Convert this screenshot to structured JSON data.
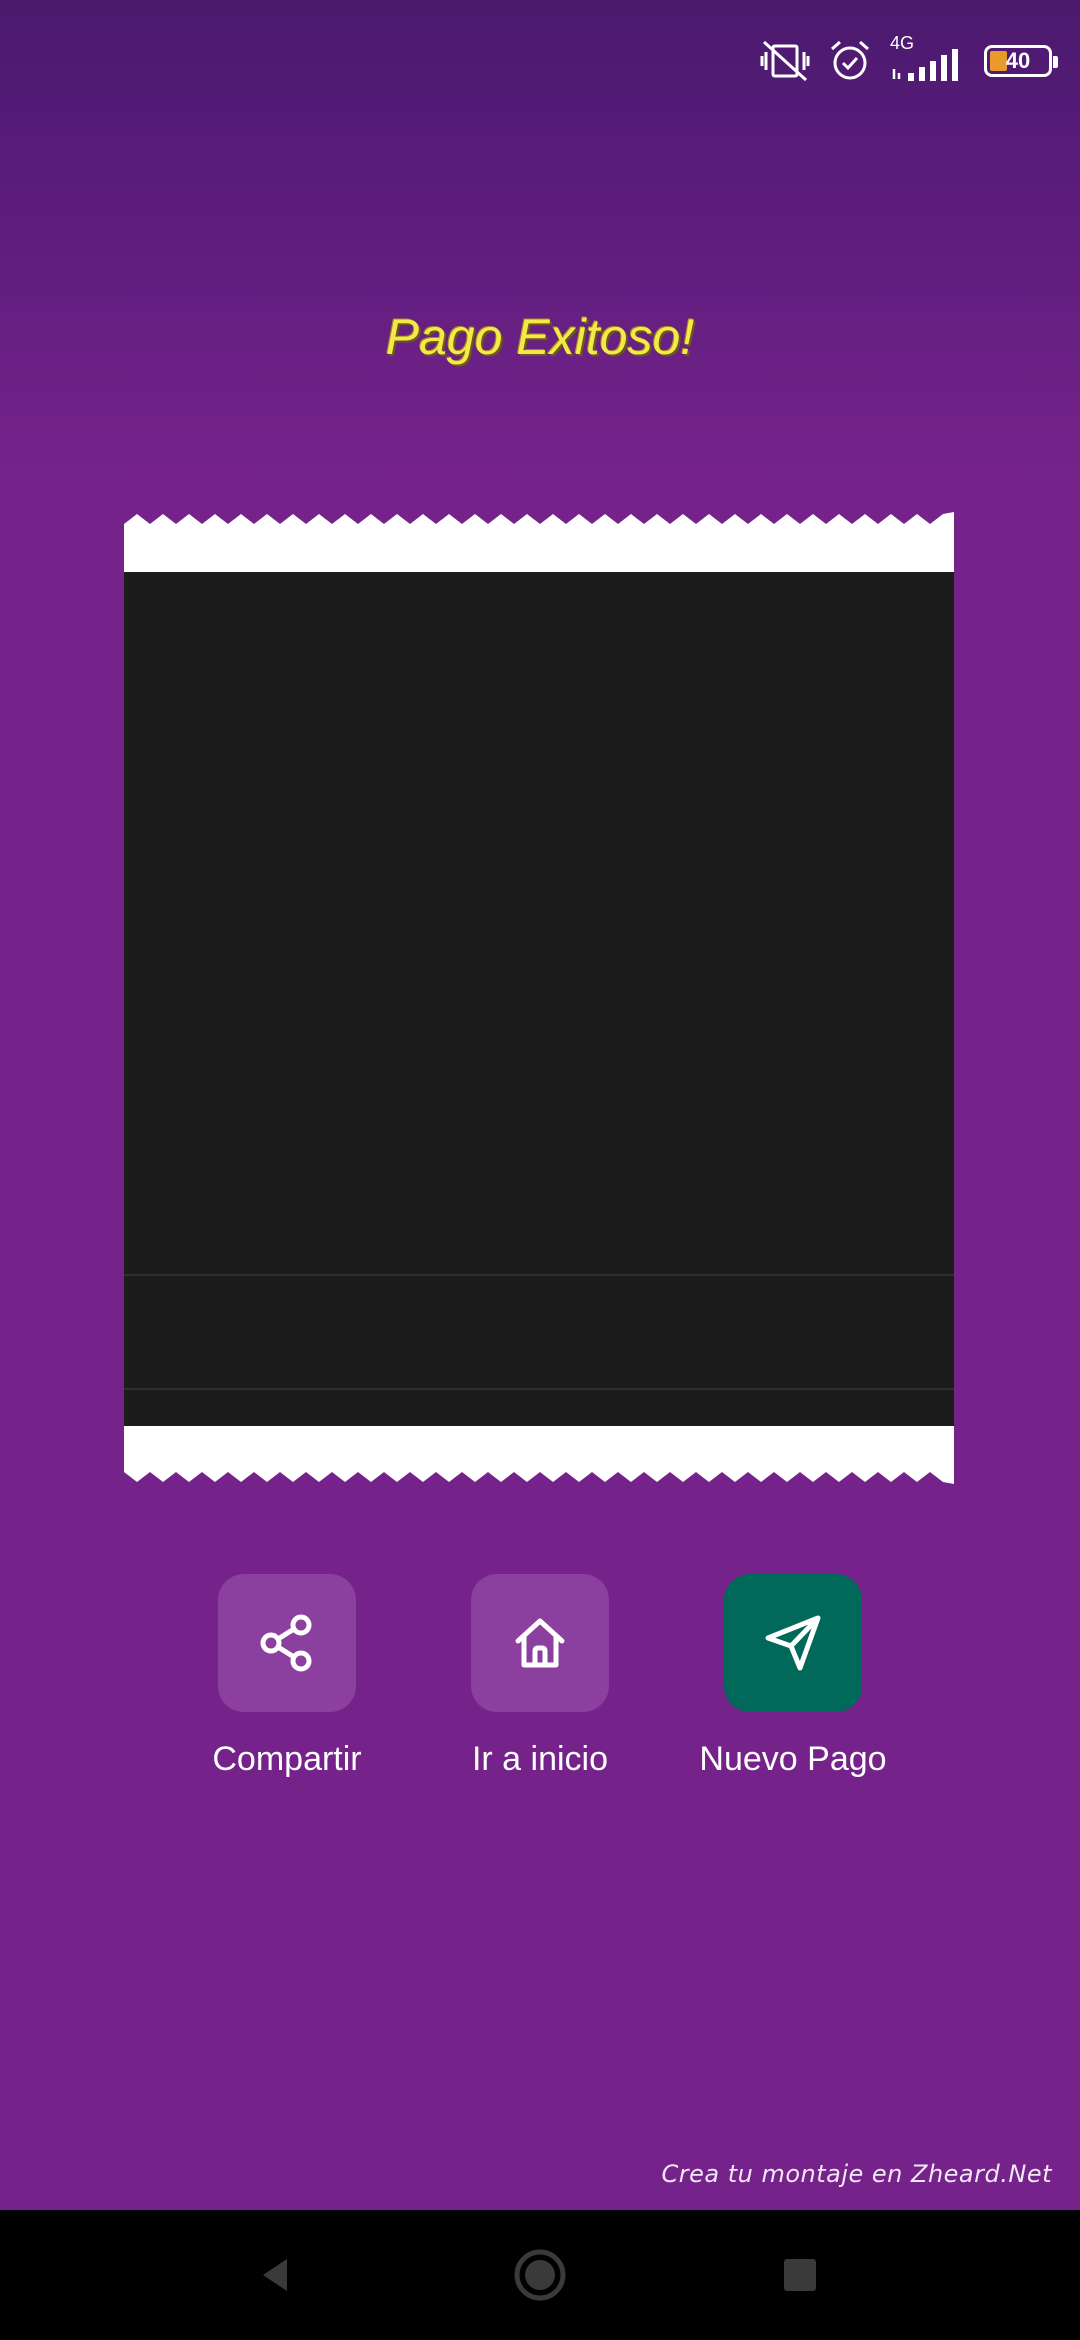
{
  "status_bar": {
    "network": "4G",
    "battery": "40",
    "icons": [
      "vibrate-off-icon",
      "alarm-icon",
      "signal-icon",
      "battery-icon"
    ]
  },
  "page": {
    "title": "Pago Exitoso!"
  },
  "actions": [
    {
      "label": "Compartir",
      "icon": "share-icon"
    },
    {
      "label": "Ir a inicio",
      "icon": "home-icon"
    },
    {
      "label": "Nuevo Pago",
      "icon": "send-icon"
    }
  ],
  "watermark": "Crea tu montaje en Zheard.Net",
  "colors": {
    "background": "#75238a",
    "title": "#f5e94a",
    "soft_button": "#8b3f9e",
    "primary_button": "#01695a",
    "receipt_body": "#1c1c1c"
  },
  "nav": {
    "icons": [
      "back-icon",
      "home-circle-icon",
      "recents-icon"
    ]
  }
}
